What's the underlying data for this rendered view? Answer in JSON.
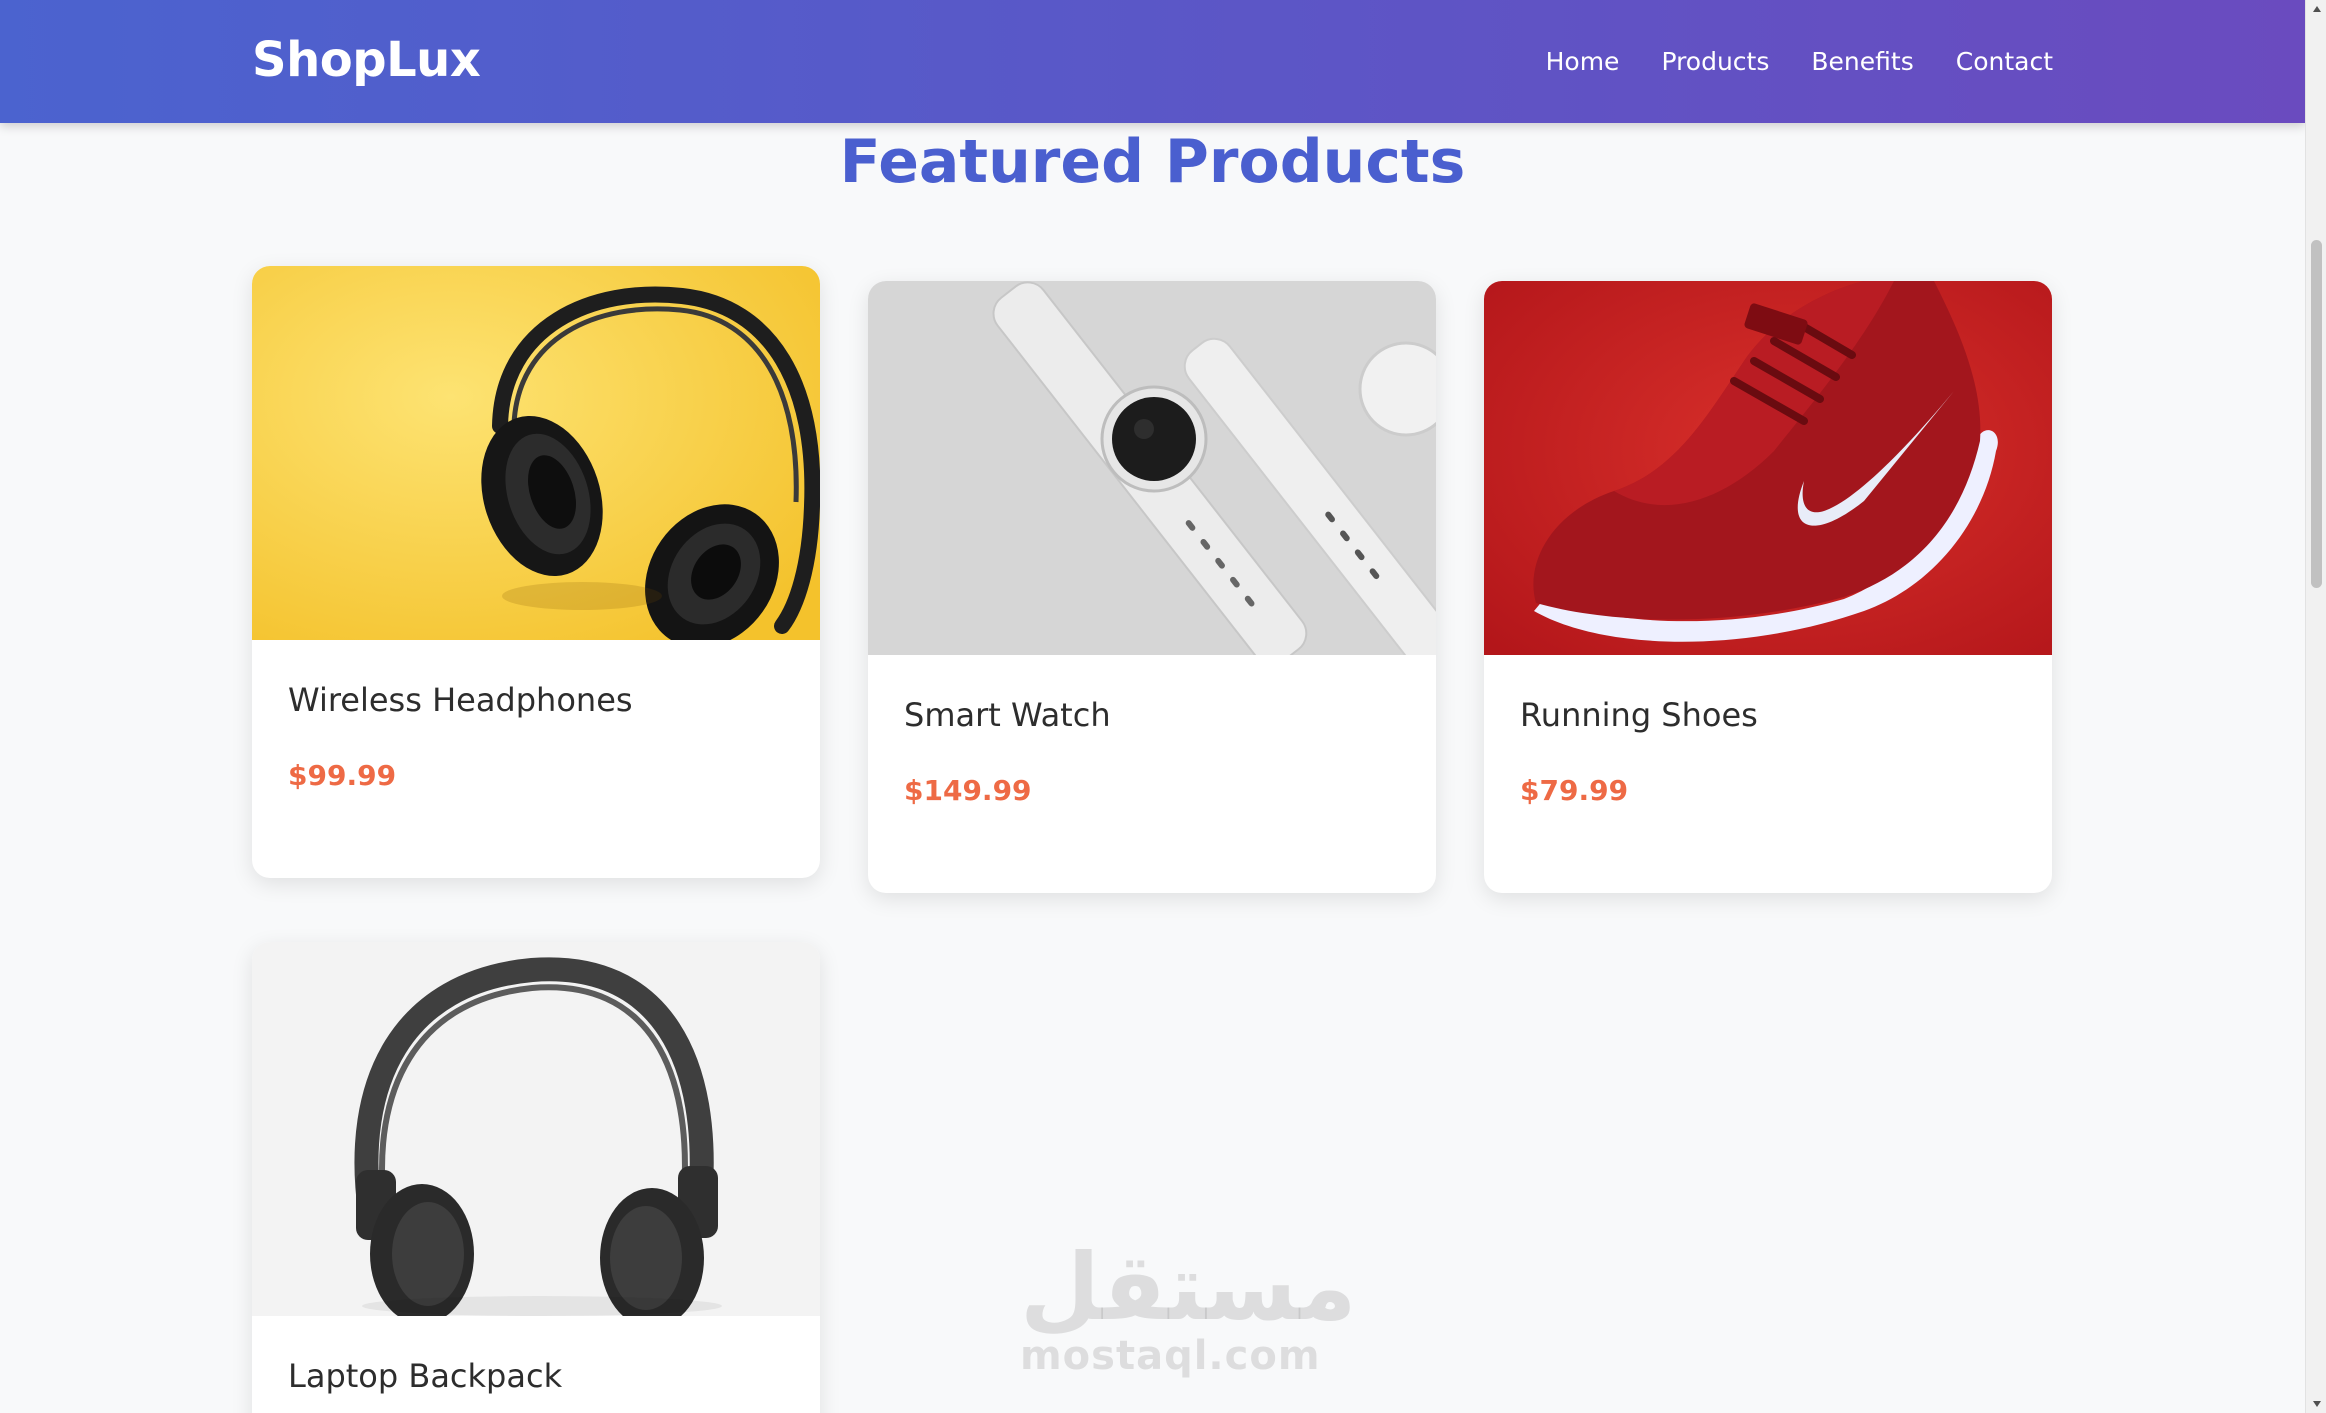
{
  "navbar": {
    "brand": "ShopLux",
    "links": [
      "Home",
      "Products",
      "Benefits",
      "Contact"
    ]
  },
  "section": {
    "title": "Featured Products"
  },
  "products": [
    {
      "name": "Wireless Headphones",
      "price": "$99.99",
      "image": "black-headphones-on-yellow-photo"
    },
    {
      "name": "Smart Watch",
      "price": "$149.99",
      "image": "white-smart-watches-photo"
    },
    {
      "name": "Running Shoes",
      "price": "$79.99",
      "image": "red-nike-running-shoe-photo"
    },
    {
      "name": "Laptop Backpack",
      "price": "",
      "image": "gray-headphones-on-white-photo"
    }
  ],
  "watermark": {
    "logo": "مستقل",
    "text": "mostaql.com"
  },
  "colors": {
    "nav_gradient_start": "#4b63cf",
    "nav_gradient_end": "#6a4bbf",
    "title": "#4a5fcf",
    "price": "#ee6a45",
    "background": "#f8f9fa"
  }
}
